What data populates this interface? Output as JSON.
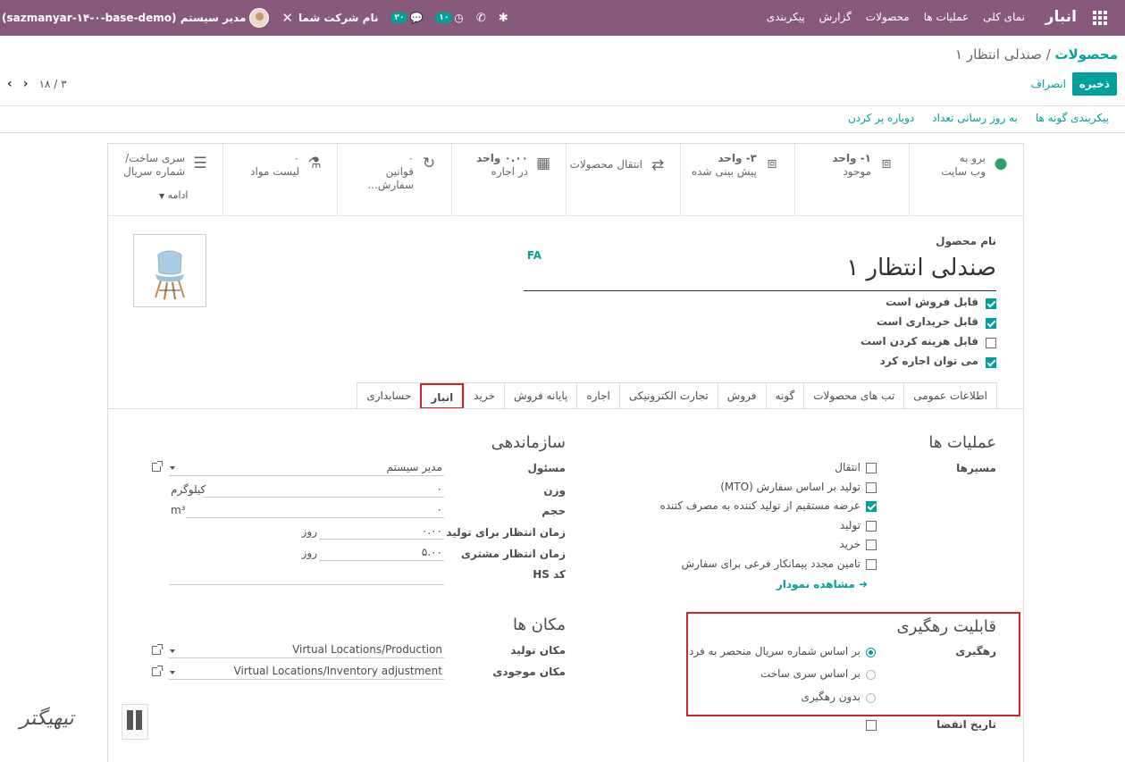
{
  "navbar": {
    "app_name": "انبار",
    "menu": [
      "نمای کلی",
      "عملیات ها",
      "محصولات",
      "گزارش",
      "پیکربندی"
    ],
    "company": "نام شرکت شما",
    "messages_count": "۲۰",
    "activities_count": "۱۰",
    "user": "مدیر سیستم (sazmanyar-۱۴-۰-base-demo)"
  },
  "breadcrumb": {
    "parent": "محصولات",
    "separator": "/",
    "current": "صندلی انتظار ۱"
  },
  "actions": {
    "save": "ذخیره",
    "discard": "انصراف"
  },
  "pager": {
    "text": "۳ / ۱۸"
  },
  "top_actions": [
    "پیکربندی گونه ها",
    "به روز رسانی تعداد",
    "دوباره پر کردن"
  ],
  "stat_buttons": [
    {
      "label": "برو به",
      "sub": "وب سایت",
      "icon": "globe-icon"
    },
    {
      "label": "۱- واحد",
      "sub": "موجود",
      "icon": "cubes-icon"
    },
    {
      "label": "۳- واحد",
      "sub": "پیش بینی شده",
      "icon": "cubes-icon"
    },
    {
      "label": "انتقال محصولات",
      "sub": "",
      "icon": "exchange-icon"
    },
    {
      "label": "۰.۰۰ واحد",
      "sub": "در اجاره",
      "icon": "calendar-icon"
    },
    {
      "label": "۰",
      "sub": "قوانین سفارش...",
      "icon": "refresh-icon"
    },
    {
      "label": "۰",
      "sub": "لیست مواد",
      "icon": "flask-icon"
    },
    {
      "label": "سری ساخت/",
      "sub": "شماره سریال",
      "icon": "bars-icon"
    }
  ],
  "more_label": "ادامه",
  "product": {
    "name_label": "نام محصول",
    "lang": "FA",
    "name": "صندلی انتظار ۱",
    "flags": [
      {
        "label": "قابل فروش است",
        "checked": true
      },
      {
        "label": "قابل خریداری است",
        "checked": true
      },
      {
        "label": "قابل هزینه کردن است",
        "checked": false
      },
      {
        "label": "می توان اجاره کرد",
        "checked": true
      }
    ]
  },
  "tabs": [
    "اطلاعات عمومی",
    "تب های محصولات",
    "گونه",
    "فروش",
    "تجارت الکترونیکی",
    "اجاره",
    "پایانه فروش",
    "خرید",
    "انبار",
    "حسابداری"
  ],
  "operations": {
    "title": "عملیات ها",
    "routes_label": "مسیرها",
    "routes": [
      {
        "label": "انتقال",
        "checked": false
      },
      {
        "label": "تولید بر اساس سفارش (MTO)",
        "checked": false
      },
      {
        "label": "عرضه مستقیم از تولید کننده به مصرف کننده",
        "checked": true
      },
      {
        "label": "تولید",
        "checked": false
      },
      {
        "label": "خرید",
        "checked": false
      },
      {
        "label": "تامین مجدد پیمانکار فرعی برای سفارش",
        "checked": false
      }
    ],
    "diagram_link": "مشاهده نمودار"
  },
  "organization": {
    "title": "سازماندهی",
    "responsible_label": "مسئول",
    "responsible": "مدیر سیستم",
    "weight_label": "وزن",
    "weight": "۰",
    "weight_unit": "کیلوگرم",
    "volume_label": "حجم",
    "volume": "۰",
    "volume_unit": "m³",
    "mfg_lead_label": "زمان انتظار برای تولید",
    "mfg_lead": "۰.۰۰",
    "customer_lead_label": "زمان انتظار مشتری",
    "customer_lead": "۵.۰۰",
    "day_unit": "روز",
    "hs_label": "کد HS"
  },
  "locations": {
    "title": "مکان ها",
    "production_label": "مکان تولید",
    "production": "Virtual Locations/Production",
    "inventory_label": "مکان موجودی",
    "inventory": "Virtual Locations/Inventory adjustment"
  },
  "traceability": {
    "title": "قابلیت رهگیری",
    "tracking_label": "رهگیری",
    "options": [
      {
        "label": "بر اساس شماره سریال منحصر به فرد",
        "selected": true
      },
      {
        "label": "بر اساس سری ساخت",
        "selected": false
      },
      {
        "label": "بدون رهگیری",
        "selected": false
      }
    ],
    "expiry_label": "تاریخ انقضا"
  },
  "watermark": "تیهیگتر",
  "colors": {
    "navbar": "#875a7b",
    "accent": "#00a09d",
    "highlight": "#d0232c"
  }
}
